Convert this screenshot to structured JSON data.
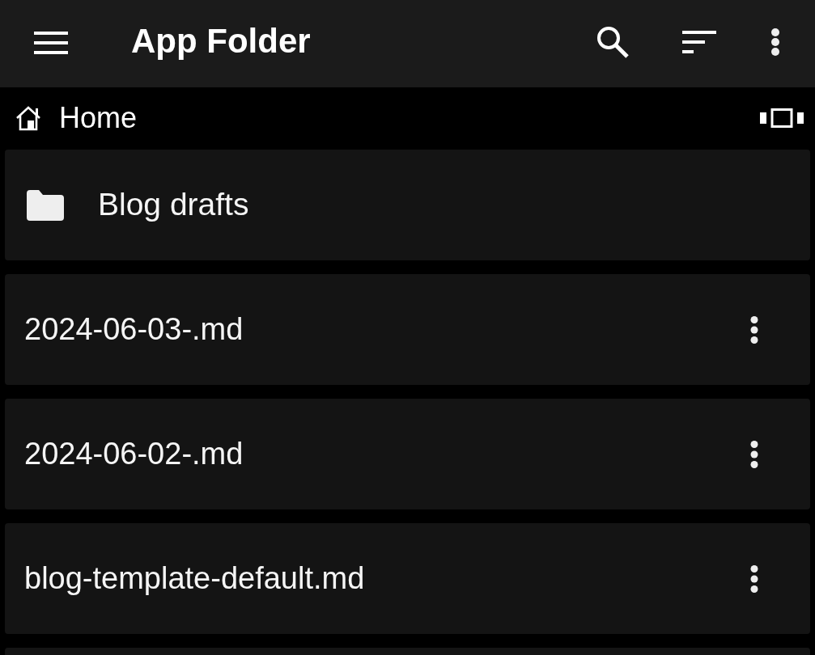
{
  "app_bar": {
    "title": "App Folder"
  },
  "breadcrumb": [
    {
      "label": "Home"
    }
  ],
  "entries": [
    {
      "kind": "folder",
      "name": "Blog drafts"
    },
    {
      "kind": "file",
      "name": "2024-06-03-.md"
    },
    {
      "kind": "file",
      "name": "2024-06-02-.md"
    },
    {
      "kind": "file",
      "name": "blog-template-default.md"
    }
  ]
}
